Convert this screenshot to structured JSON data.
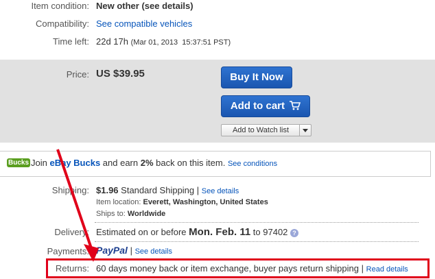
{
  "details": {
    "condition_label": "Item condition:",
    "condition_value": "New other (see details)",
    "compat_label": "Compatibility:",
    "compat_link": "See compatible vehicles",
    "time_label": "Time left:",
    "time_value": "22d 17h",
    "time_end": "(Mar 01, 2013  15:37:51 PST)"
  },
  "price": {
    "label": "Price:",
    "value": "US $39.95",
    "buy_now": "Buy It Now",
    "add_to_cart": "Add to cart",
    "watch_list": "Add to Watch list"
  },
  "bucks": {
    "badge": "Bucks",
    "join": "Join ",
    "brand": "eBay Bucks",
    "earn": " and earn ",
    "percent": "2%",
    "rest": " back on this item.",
    "link": "See conditions"
  },
  "shipping": {
    "label": "Shipping:",
    "cost": "$1.96",
    "method": "Standard Shipping",
    "sep": "|",
    "link": "See details",
    "location_label": "Item location:",
    "location_value": "Everett, Washington, United States",
    "ships_label": "Ships to:",
    "ships_value": "Worldwide"
  },
  "delivery": {
    "label": "Delivery:",
    "prefix": "Estimated on or before",
    "date": "Mon. Feb. 11",
    "to": "to 97402",
    "help": "?"
  },
  "payments": {
    "label": "Payments:",
    "paypal": "PayPal",
    "sep": "|",
    "link": "See details"
  },
  "returns": {
    "label": "Returns:",
    "text": "60 days money back or item exchange, buyer pays return shipping",
    "sep": "|",
    "link": "Read details"
  },
  "colors": {
    "link": "#0654ba",
    "button": "#1a56b0",
    "annotation": "#e0001a",
    "panel": "#e1e1e1"
  }
}
